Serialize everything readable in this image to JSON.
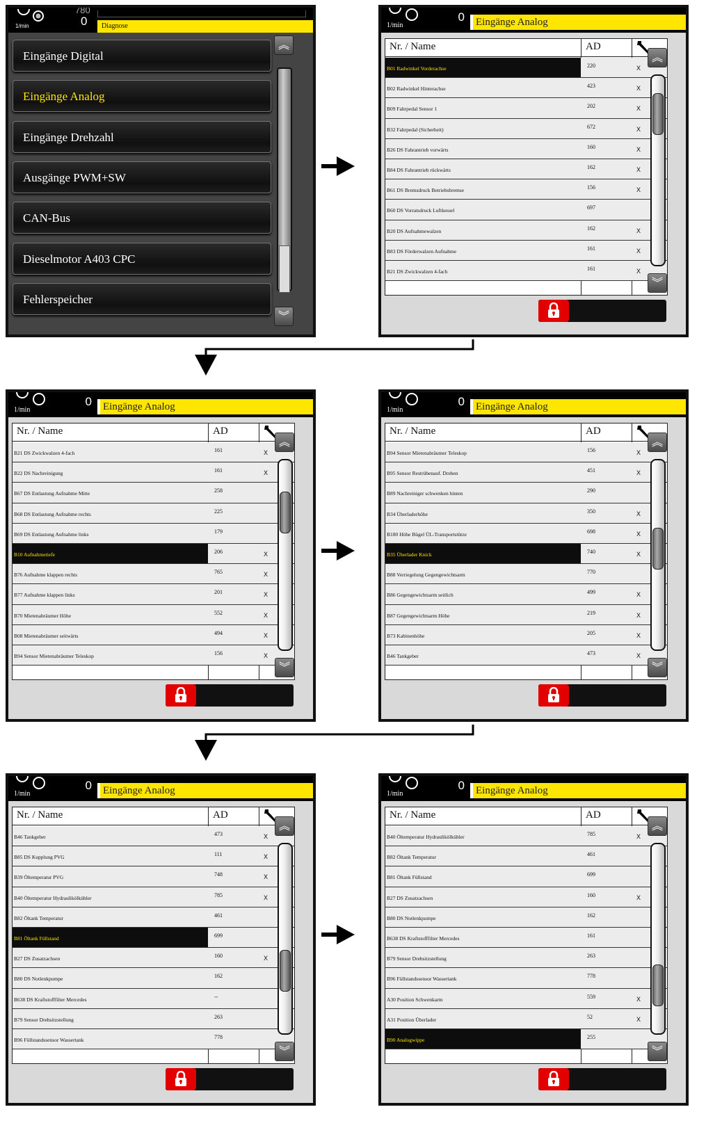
{
  "menu_panel": {
    "header_value_top": "780",
    "header_value": "0",
    "unit": "1/min",
    "title": "Diagnose",
    "items": [
      {
        "label": "Eingänge Digital",
        "active": false
      },
      {
        "label": "Eingänge Analog",
        "active": true
      },
      {
        "label": "Eingänge Drehzahl",
        "active": false
      },
      {
        "label": "Ausgänge PWM+SW",
        "active": false
      },
      {
        "label": "CAN-Bus",
        "active": false
      },
      {
        "label": "Dieselmotor A403 CPC",
        "active": false
      },
      {
        "label": "Fehlerspeicher",
        "active": false
      }
    ]
  },
  "screens": [
    {
      "unit": "1/min",
      "value": "0",
      "title": "Eingänge Analog",
      "col_name": "Nr. / Name",
      "col_ad": "AD",
      "scroll_position": 0.1,
      "rows": [
        {
          "name": "B01 Radwinkel Vorderachse",
          "ad": "220",
          "x": "X",
          "selected": true
        },
        {
          "name": "B02 Radwinkel Hinterachse",
          "ad": "423",
          "x": "X"
        },
        {
          "name": "B09 Fahrpedal Sensor 1",
          "ad": "202",
          "x": "X"
        },
        {
          "name": "B32 Fahrpedal (Sicherheit)",
          "ad": "672",
          "x": "X"
        },
        {
          "name": "B26 DS Fahrantrieb vorwärts",
          "ad": "160",
          "x": "X"
        },
        {
          "name": "B84 DS Fahrantrieb rückwärts",
          "ad": "162",
          "x": "X"
        },
        {
          "name": "B61 DS Bremsdruck Betriebsbremse",
          "ad": "156",
          "x": "X"
        },
        {
          "name": "B60 DS Vorratsdruck Luftkessel",
          "ad": "697",
          "x": ""
        },
        {
          "name": "B20 DS Aufnahmewalzen",
          "ad": "162",
          "x": "X"
        },
        {
          "name": "B83 DS Förderwalzen Aufnahme",
          "ad": "161",
          "x": "X"
        },
        {
          "name": "B21 DS Zwickwalzen 4-fach",
          "ad": "161",
          "x": "X"
        }
      ]
    },
    {
      "unit": "1/min",
      "value": "0",
      "title": "Eingänge Analog",
      "col_name": "Nr. / Name",
      "col_ad": "AD",
      "scroll_position": 0.2,
      "rows": [
        {
          "name": "B21 DS Zwickwalzen 4-fach",
          "ad": "161",
          "x": "X"
        },
        {
          "name": "B22 DS Nachreinigung",
          "ad": "161",
          "x": "X"
        },
        {
          "name": "B67 DS Entlastung Aufnahme Mitte",
          "ad": "258",
          "x": ""
        },
        {
          "name": "B68 DS Entlastung Aufnahme rechts",
          "ad": "225",
          "x": ""
        },
        {
          "name": "B69 DS Entlastung Aufnahme links",
          "ad": "179",
          "x": ""
        },
        {
          "name": "B10 Aufnahmetiefe",
          "ad": "206",
          "x": "X",
          "selected": true
        },
        {
          "name": "B76 Aufnahme klappen rechts",
          "ad": "765",
          "x": "X"
        },
        {
          "name": "B77 Aufnahme klappen links",
          "ad": "201",
          "x": "X"
        },
        {
          "name": "B70 Mietenabräumer Höhe",
          "ad": "552",
          "x": "X"
        },
        {
          "name": "B08 Mietenabräumer seitwärts",
          "ad": "494",
          "x": "X"
        },
        {
          "name": "B94 Sensor Mietenabräumer Teleskop",
          "ad": "156",
          "x": "X"
        }
      ]
    },
    {
      "unit": "1/min",
      "value": "0",
      "title": "Eingänge Analog",
      "col_name": "Nr. / Name",
      "col_ad": "AD",
      "scroll_position": 0.45,
      "rows": [
        {
          "name": "B94 Sensor Mietenabräumer Teleskop",
          "ad": "156",
          "x": "X"
        },
        {
          "name": "B95 Sensor Restrübenauf. Drehen",
          "ad": "451",
          "x": "X"
        },
        {
          "name": "B89 Nachreiniger schwenken hinten",
          "ad": "290",
          "x": ""
        },
        {
          "name": "B34 Überladerhöhe",
          "ad": "350",
          "x": "X"
        },
        {
          "name": "B180 Höhe Bügel ÜL-Transportstütze",
          "ad": "698",
          "x": "X"
        },
        {
          "name": "B35 Überlader Knick",
          "ad": "740",
          "x": "X",
          "selected": true
        },
        {
          "name": "B88 Verriegelung Gegengewichtsarm",
          "ad": "770",
          "x": ""
        },
        {
          "name": "B86 Gegengewichtsarm seitlich",
          "ad": "499",
          "x": "X"
        },
        {
          "name": "B87 Gegengewichtsarm Höhe",
          "ad": "219",
          "x": "X"
        },
        {
          "name": "B73 Kabinenhöhe",
          "ad": "205",
          "x": "X"
        },
        {
          "name": "B46 Tankgeber",
          "ad": "473",
          "x": "X"
        }
      ]
    },
    {
      "unit": "1/min",
      "value": "0",
      "title": "Eingänge Analog",
      "col_name": "Nr. / Name",
      "col_ad": "AD",
      "scroll_position": 0.72,
      "rows": [
        {
          "name": "B46 Tankgeber",
          "ad": "473",
          "x": "X"
        },
        {
          "name": "B85 DS Kupplung PVG",
          "ad": "111",
          "x": "X"
        },
        {
          "name": "B39 Öltemperatur PVG",
          "ad": "748",
          "x": "X"
        },
        {
          "name": "B40 Öltemperatur Hydraulikölkühler",
          "ad": "785",
          "x": "X"
        },
        {
          "name": "B82 Öltank Temperatur",
          "ad": "461",
          "x": ""
        },
        {
          "name": "B81 Öltank Füllstand",
          "ad": "699",
          "x": "",
          "selected": true
        },
        {
          "name": "B27 DS Zusatzachsen",
          "ad": "160",
          "x": "X"
        },
        {
          "name": "B80 DS Notlenkpumpe",
          "ad": "162",
          "x": ""
        },
        {
          "name": "B638 DS Kraftstofffilter Mercedes",
          "ad": "--",
          "x": ""
        },
        {
          "name": "B79 Sensor Drehsitzstellung",
          "ad": "263",
          "x": ""
        },
        {
          "name": "B96 Füllstandssensor Wassertank",
          "ad": "778",
          "x": ""
        }
      ]
    },
    {
      "unit": "1/min",
      "value": "0",
      "title": "Eingänge Analog",
      "col_name": "Nr. / Name",
      "col_ad": "AD",
      "scroll_position": 0.82,
      "rows": [
        {
          "name": "B40 Öltemperatur Hydraulikölkühler",
          "ad": "785",
          "x": "X"
        },
        {
          "name": "B82 Öltank Temperatur",
          "ad": "461",
          "x": ""
        },
        {
          "name": "B81 Öltank Füllstand",
          "ad": "699",
          "x": ""
        },
        {
          "name": "B27 DS Zusatzachsen",
          "ad": "160",
          "x": "X"
        },
        {
          "name": "B80 DS Notlenkpumpe",
          "ad": "162",
          "x": ""
        },
        {
          "name": "B638 DS Kraftstofffilter Mercedes",
          "ad": "161",
          "x": ""
        },
        {
          "name": "B79 Sensor Drehsitzstellung",
          "ad": "263",
          "x": ""
        },
        {
          "name": "B96 Füllstandssensor Wassertank",
          "ad": "778",
          "x": ""
        },
        {
          "name": "A30 Position Schwenkarm",
          "ad": "559",
          "x": "X"
        },
        {
          "name": "A31 Position Überlader",
          "ad": "52",
          "x": "X"
        },
        {
          "name": "B90 Analogwippe",
          "ad": "255",
          "x": "",
          "selected": true
        }
      ]
    }
  ]
}
